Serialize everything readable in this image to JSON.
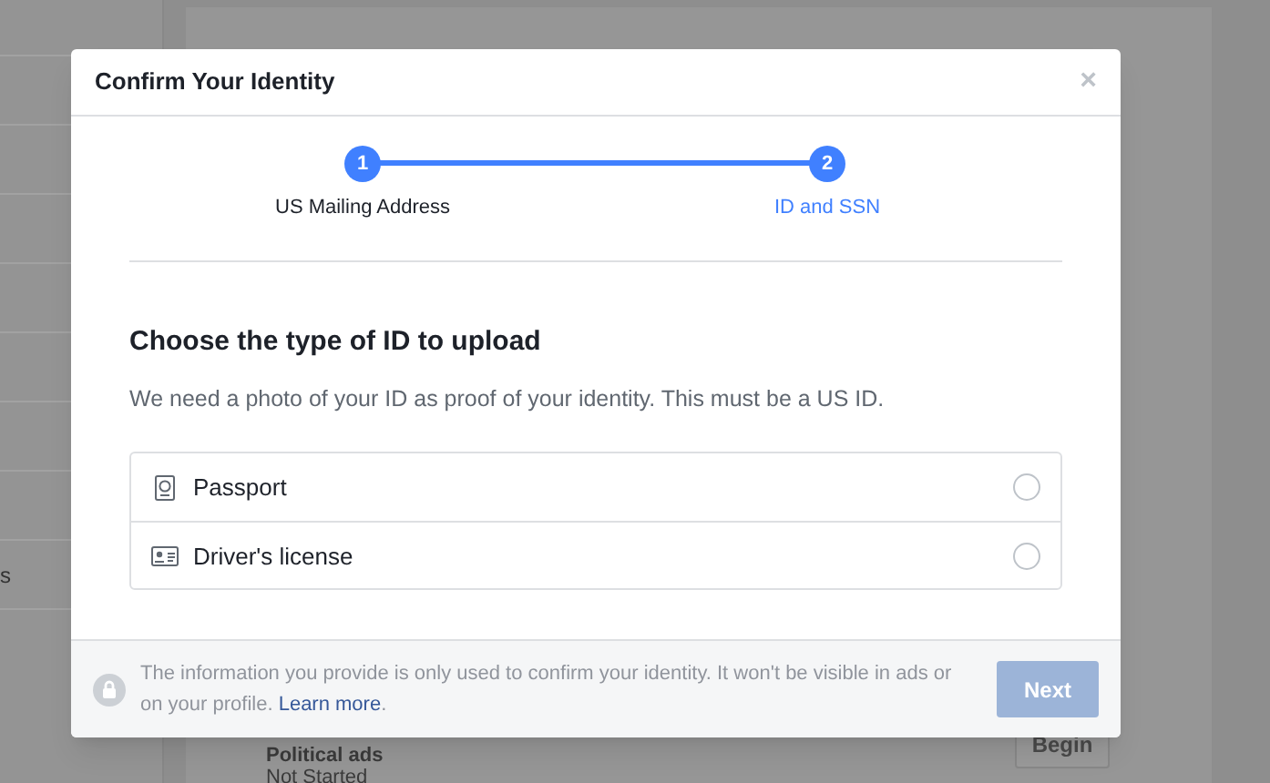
{
  "background": {
    "sidebar_items": [
      {
        "label": "s"
      }
    ],
    "political_ads": {
      "title": "Political ads",
      "status": "Not Started",
      "button": "Begin"
    }
  },
  "dialog": {
    "title": "Confirm Your Identity",
    "close": "×",
    "steps": [
      {
        "number": "1",
        "label": "US Mailing Address",
        "selected": false
      },
      {
        "number": "2",
        "label": "ID and SSN",
        "selected": true
      }
    ],
    "heading": "Choose the type of ID to upload",
    "description": "We need a photo of your ID as proof of your identity. This must be a US ID.",
    "options": [
      {
        "kind": "passport",
        "label": "Passport",
        "selected": false
      },
      {
        "kind": "license",
        "label": "Driver's license",
        "selected": false
      }
    ],
    "footer": {
      "text": "The information you provide is only used to confirm your identity. It won't be visible in ads or on your profile. ",
      "link": "Learn more",
      "suffix": "."
    },
    "next_button": {
      "label": "Next",
      "disabled": true
    }
  }
}
